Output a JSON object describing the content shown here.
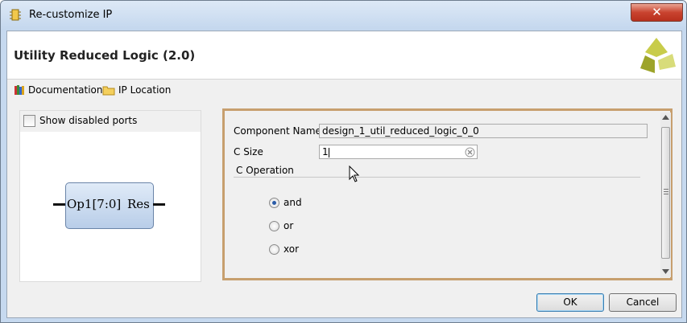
{
  "window": {
    "title": "Re-customize IP",
    "close_label": "✕"
  },
  "header": {
    "title": "Utility Reduced Logic (2.0)"
  },
  "links": {
    "documentation": "Documentation",
    "ip_location": "IP Location"
  },
  "left_panel": {
    "show_disabled_ports_label": "Show disabled ports",
    "show_disabled_ports_checked": false,
    "block_label": "Op1[7:0]",
    "block_output_label": "Res"
  },
  "form": {
    "component_name_label": "Component Name",
    "component_name_value": "design_1_util_reduced_logic_0_0",
    "c_size_label": "C Size",
    "c_size_value": "1",
    "c_operation_label": "C Operation",
    "operations": [
      {
        "label": "and",
        "selected": true
      },
      {
        "label": "or",
        "selected": false
      },
      {
        "label": "xor",
        "selected": false
      }
    ]
  },
  "buttons": {
    "ok": "OK",
    "cancel": "Cancel"
  },
  "colors": {
    "accent_border": "#c79f6e",
    "logo": "#b5bd2e",
    "close": "#c9432f"
  }
}
